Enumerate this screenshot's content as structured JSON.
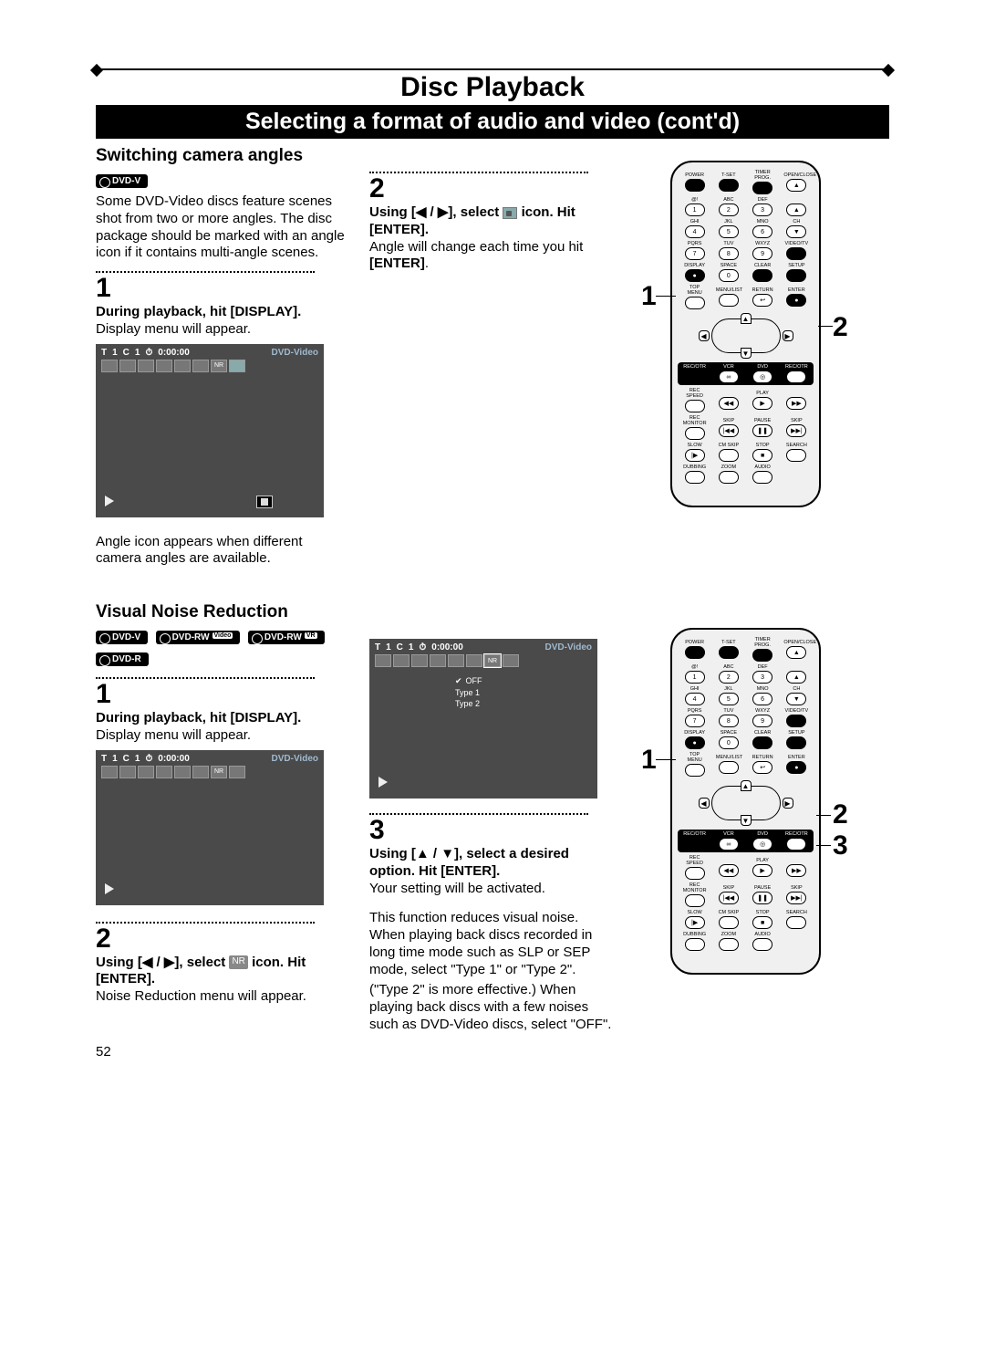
{
  "page_title": "Disc Playback",
  "subtitle_bar": "Selecting a format of audio and video (cont'd)",
  "page_number": "52",
  "angles": {
    "section_title": "Switching camera angles",
    "badge": "DVD-V",
    "intro": "Some DVD-Video discs feature scenes shot from two or more angles. The disc package should be marked with an angle icon if it contains multi-angle scenes.",
    "step1_num": "1",
    "step1_bold": "During playback, hit [DISPLAY].",
    "step1_text": "Display menu will appear.",
    "screen1": {
      "t": "T",
      "t_val": "1",
      "c": "C",
      "c_val": "1",
      "time": "0:00:00",
      "mode": "DVD-Video"
    },
    "step1_caption": "Angle icon appears when different camera angles are available.",
    "step2_num": "2",
    "step2_bold_a": "Using [",
    "step2_arrows": "◀ / ▶",
    "step2_bold_b": "], select ",
    "step2_bold_c": " icon. Hit [ENTER].",
    "step2_text": "Angle will change each time you hit ",
    "step2_text_bold": "[ENTER]",
    "step2_text_end": "."
  },
  "vnr": {
    "section_title": "Visual Noise Reduction",
    "badges": {
      "b1": "DVD-V",
      "b2": "DVD-RW",
      "b2_sup": "Video",
      "b3": "DVD-RW",
      "b3_sup": "VR",
      "b4": "DVD-R"
    },
    "step1_num": "1",
    "step1_bold": "During playback, hit [DISPLAY].",
    "step1_text": "Display menu will appear.",
    "screen1": {
      "t": "T",
      "t_val": "1",
      "c": "C",
      "c_val": "1",
      "time": "0:00:00",
      "mode": "DVD-Video"
    },
    "step2_num": "2",
    "step2_bold_a": "Using [",
    "step2_arrows": "◀ / ▶",
    "step2_bold_b": "], select ",
    "step2_nr": "NR",
    "step2_bold_c": " icon. Hit [ENTER].",
    "step2_text": "Noise Reduction menu will appear.",
    "screen2": {
      "t": "T",
      "t_val": "1",
      "c": "C",
      "c_val": "1",
      "time": "0:00:00",
      "mode": "DVD-Video",
      "opt1": "OFF",
      "opt2": "Type 1",
      "opt3": "Type 2"
    },
    "step3_num": "3",
    "step3_bold_a": "Using [",
    "step3_arrows": "▲ / ▼",
    "step3_bold_b": "], select a desired option. Hit [ENTER].",
    "step3_text": "Your setting will be activated.",
    "desc1": "This function reduces visual noise. When playing back discs recorded in long time mode such as SLP or SEP mode, select \"Type 1\" or \"Type 2\".",
    "desc2": "(\"Type 2\" is more effective.) When playing back discs with a few noises such as DVD-Video discs, select \"OFF\"."
  },
  "remote": {
    "power": "POWER",
    "tset": "T-SET",
    "timerprog": "TIMER PROG.",
    "openclose": "OPEN/CLOSE",
    "sym": "@!",
    "abc": "ABC",
    "def": "DEF",
    "n1": "1",
    "n2": "2",
    "n3": "3",
    "ghi": "GHI",
    "jkl": "JKL",
    "mno": "MNO",
    "ch": "CH",
    "n4": "4",
    "n5": "5",
    "n6": "6",
    "pqrs": "PQRS",
    "tuv": "TUV",
    "wxyz": "WXYZ",
    "videotv": "VIDEO/TV",
    "n7": "7",
    "n8": "8",
    "n9": "9",
    "display": "DISPLAY",
    "space": "SPACE",
    "clear": "CLEAR",
    "setup": "SETUP",
    "n0": "0",
    "topmenu": "TOP MENU",
    "menulist": "MENU/LIST",
    "return": "RETURN",
    "enter": "ENTER",
    "recotr": "REC/OTR",
    "vcr": "VCR",
    "dvd": "DVD",
    "recspeed": "REC SPEED",
    "play": "PLAY",
    "recmon": "REC MONITOR",
    "skip": "SKIP",
    "pause": "PAUSE",
    "slow": "SLOW",
    "cmskip": "CM SKIP",
    "stop": "STOP",
    "search": "SEARCH",
    "dubbing": "DUBBING",
    "zoom": "ZOOM",
    "audio": "AUDIO",
    "up": "▲",
    "down": "▼",
    "left": "◀",
    "right": "▶"
  },
  "callouts": {
    "a1": "1",
    "a2": "2",
    "b1": "1",
    "b2": "2",
    "b3": "3"
  }
}
